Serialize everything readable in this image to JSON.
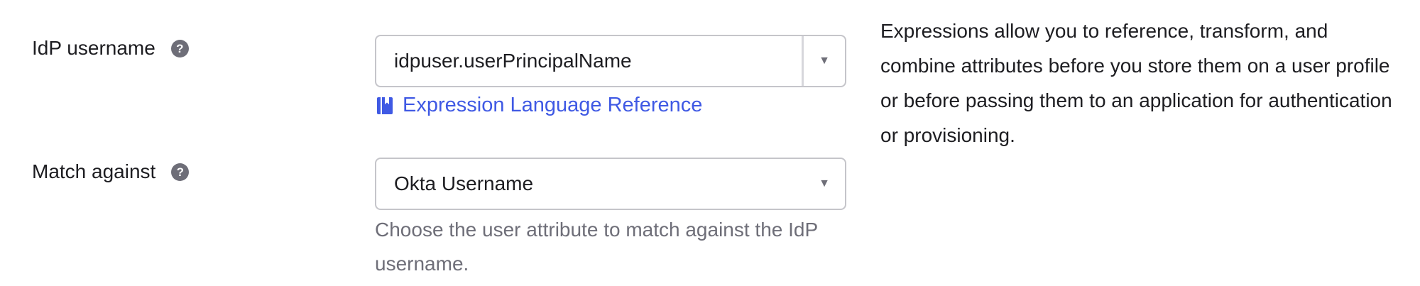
{
  "idp_username": {
    "label": "IdP username",
    "help": "?",
    "value": "idpuser.userPrincipalName",
    "link_label": "Expression Language Reference"
  },
  "match_against": {
    "label": "Match against",
    "help": "?",
    "selected": "Okta Username",
    "hint": "Choose the user attribute to match against the IdP username."
  },
  "side_note": "Expressions allow you to reference, transform, and combine attributes before you store them on a user profile or before passing them to an application for authentication or provisioning.",
  "colors": {
    "link": "#3f59e4",
    "text": "#1d1d21",
    "muted": "#6e6e78",
    "border": "#c5c5ca"
  }
}
